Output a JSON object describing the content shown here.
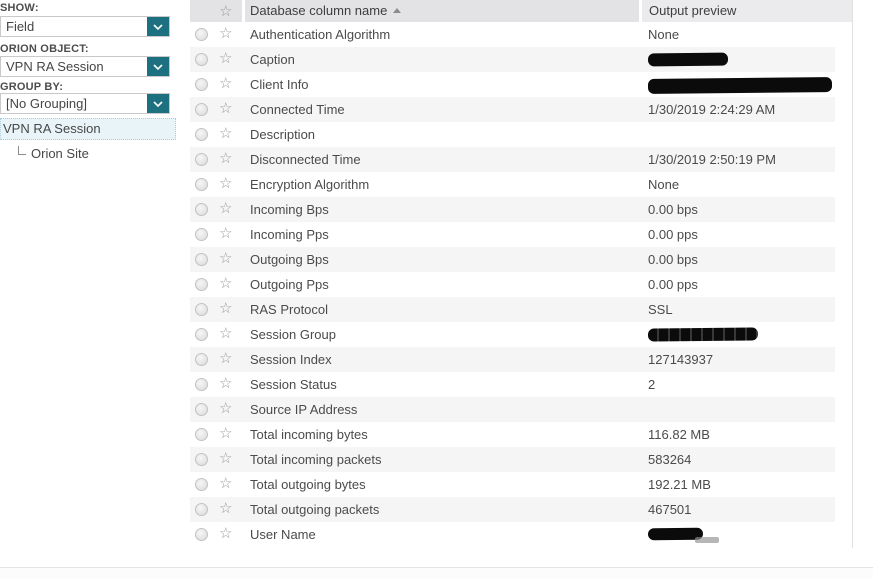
{
  "sidebar": {
    "show_label": "SHOW:",
    "show_value": "Field",
    "orion_object_label": "ORION OBJECT:",
    "orion_object_value": "VPN RA Session",
    "group_by_label": "GROUP BY:",
    "group_by_value": "[No Grouping]",
    "tree": {
      "selected_item": "VPN RA Session",
      "child_item": "Orion Site"
    }
  },
  "table": {
    "columns": {
      "name_header": "Database column name",
      "preview_header": "Output preview"
    },
    "sort": {
      "column": "Database column name",
      "direction": "ascending"
    },
    "rows": [
      {
        "name": "Authentication Algorithm",
        "preview": "None"
      },
      {
        "name": "Caption",
        "preview": "",
        "redacted": true,
        "redaction_width": 80,
        "redaction_height": 13
      },
      {
        "name": "Client Info",
        "preview": "",
        "redacted": true,
        "redaction_width": 184,
        "redaction_height": 15
      },
      {
        "name": "Connected Time",
        "preview": "1/30/2019 2:24:29 AM"
      },
      {
        "name": "Description",
        "preview": ""
      },
      {
        "name": "Disconnected Time",
        "preview": "1/30/2019 2:50:19 PM"
      },
      {
        "name": "Encryption Algorithm",
        "preview": "None"
      },
      {
        "name": "Incoming Bps",
        "preview": "0.00 bps"
      },
      {
        "name": "Incoming Pps",
        "preview": "0.00 pps"
      },
      {
        "name": "Outgoing Bps",
        "preview": "0.00 bps"
      },
      {
        "name": "Outgoing Pps",
        "preview": "0.00 pps"
      },
      {
        "name": "RAS Protocol",
        "preview": "SSL"
      },
      {
        "name": "Session Group",
        "preview": "",
        "redacted": true,
        "redaction_width": 110,
        "redaction_height": 13,
        "speckled": true
      },
      {
        "name": "Session Index",
        "preview": "127143937"
      },
      {
        "name": "Session Status",
        "preview": "2"
      },
      {
        "name": "Source IP Address",
        "preview": ""
      },
      {
        "name": "Total incoming bytes",
        "preview": "116.82 MB"
      },
      {
        "name": "Total incoming packets",
        "preview": "583264"
      },
      {
        "name": "Total outgoing bytes",
        "preview": "192.21 MB"
      },
      {
        "name": "Total outgoing packets",
        "preview": "467501"
      },
      {
        "name": "User Name",
        "preview": "",
        "redacted": true,
        "redaction_width": 55,
        "redaction_height": 12,
        "remnant": true
      }
    ]
  },
  "colors": {
    "accent_teal": "#1d7080",
    "header_bg": "#e3e3e5",
    "header_sorted_alt_bg": "#ebebed",
    "row_alt_bg": "#f5f5f6",
    "tree_selected_bg": "#e9f4f9",
    "tree_selected_border": "#a9cede",
    "text": "#4b4b4b"
  }
}
